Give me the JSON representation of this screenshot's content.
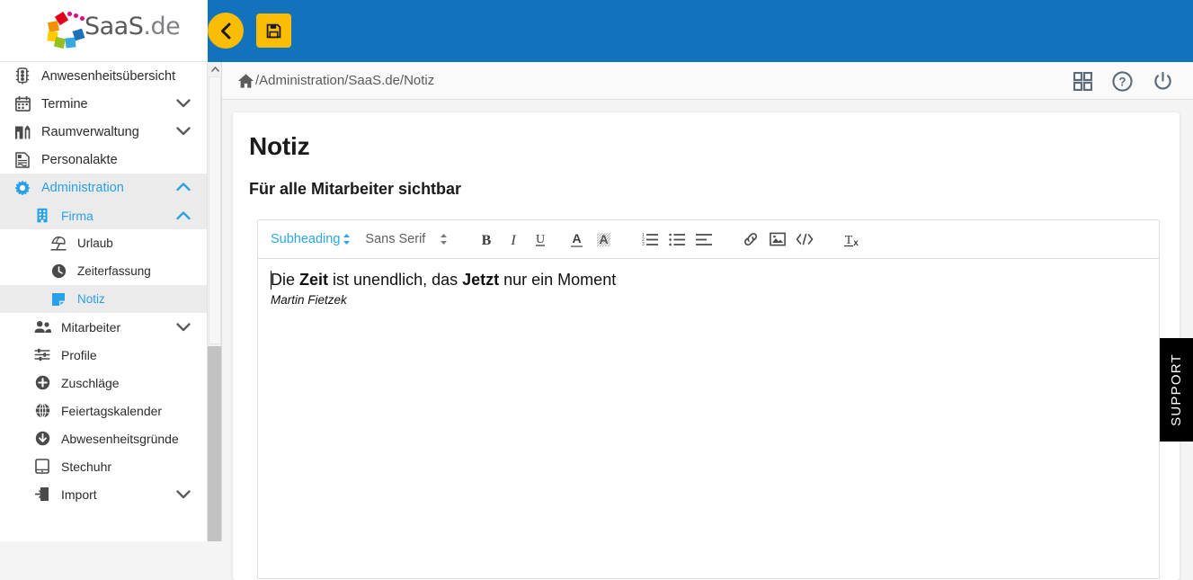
{
  "brand": {
    "name": "SaaS",
    "suffix": ".de",
    "logo_colors": [
      "#e2001a",
      "#f39200",
      "#ffcc00",
      "#95c11f",
      "#36a9e1",
      "#1d71b8",
      "#e6007e"
    ],
    "accent_yellow": "#fbbc04",
    "header_blue": "#1273bc",
    "link_blue": "#29a0e8"
  },
  "header": {
    "back_label": "Zurück",
    "back_icon": "chevron-left-icon",
    "save_label": "Speichern",
    "save_icon": "floppy-disk-icon"
  },
  "breadcrumb": {
    "home_icon": "home-icon",
    "path": "/Administration/SaaS.de/Notiz"
  },
  "header_icons": [
    {
      "name": "apps-grid-icon",
      "title": "Apps"
    },
    {
      "name": "help-circle-icon",
      "title": "Hilfe"
    },
    {
      "name": "power-icon",
      "title": "Abmelden"
    }
  ],
  "sidebar": {
    "scrollbar": {
      "up_arrow_icon": "chevron-up-icon"
    },
    "items": [
      {
        "label": "Anwesenheitsübersicht",
        "icon": "traffic-light-icon",
        "level": 1,
        "active": false,
        "chevron": ""
      },
      {
        "label": "Termine",
        "icon": "calendar-icon",
        "level": 1,
        "active": false,
        "chevron": "down"
      },
      {
        "label": "Raumverwaltung",
        "icon": "building-door-icon",
        "level": 1,
        "active": false,
        "chevron": "down"
      },
      {
        "label": "Personalakte",
        "icon": "document-person-icon",
        "level": 1,
        "active": false,
        "chevron": ""
      },
      {
        "label": "Administration",
        "icon": "gear-icon",
        "level": 1,
        "active": true,
        "chevron": "up"
      },
      {
        "label": "Firma",
        "icon": "office-building-icon",
        "level": 2,
        "active": true,
        "chevron": "up"
      },
      {
        "label": "Urlaub",
        "icon": "beach-umbrella-icon",
        "level": 3,
        "active": false,
        "chevron": ""
      },
      {
        "label": "Zeiterfassung",
        "icon": "clock-icon",
        "level": 3,
        "active": false,
        "chevron": ""
      },
      {
        "label": "Notiz",
        "icon": "note-icon",
        "level": 3,
        "active": true,
        "chevron": ""
      },
      {
        "label": "Mitarbeiter",
        "icon": "people-icon",
        "level": 2,
        "active": false,
        "chevron": "down"
      },
      {
        "label": "Profile",
        "icon": "sliders-icon",
        "level": 2,
        "active": false,
        "chevron": ""
      },
      {
        "label": "Zuschläge",
        "icon": "plus-circle-icon",
        "level": 2,
        "active": false,
        "chevron": ""
      },
      {
        "label": "Feiertagskalender",
        "icon": "globe-icon",
        "level": 2,
        "active": false,
        "chevron": ""
      },
      {
        "label": "Abwesenheitsgründe",
        "icon": "arrow-down-circle-icon",
        "level": 2,
        "active": false,
        "chevron": ""
      },
      {
        "label": "Stechuhr",
        "icon": "tablet-icon",
        "level": 2,
        "active": false,
        "chevron": ""
      },
      {
        "label": "Import",
        "icon": "import-icon",
        "level": 2,
        "active": false,
        "chevron": "down"
      }
    ]
  },
  "page": {
    "title": "Notiz",
    "subtitle": "Für alle Mitarbeiter sichtbar"
  },
  "editor": {
    "toolbar": {
      "heading_select": "Subheading",
      "font_select": "Sans Serif",
      "buttons": [
        {
          "name": "bold-button",
          "label": "B"
        },
        {
          "name": "italic-button",
          "label": "I"
        },
        {
          "name": "underline-button",
          "label": "U"
        },
        {
          "name": "text-color-button",
          "label": "A"
        },
        {
          "name": "background-color-button",
          "label": "A"
        },
        {
          "name": "ordered-list-button",
          "label": ""
        },
        {
          "name": "unordered-list-button",
          "label": ""
        },
        {
          "name": "align-button",
          "label": ""
        },
        {
          "name": "link-button",
          "label": ""
        },
        {
          "name": "image-button",
          "label": ""
        },
        {
          "name": "code-button",
          "label": "</>"
        },
        {
          "name": "clear-format-button",
          "label": "Tx"
        }
      ]
    },
    "content": {
      "line1_part1": "Die ",
      "line1_bold1": "Zeit",
      "line1_part2": " ist unendlich, das ",
      "line1_bold2": "Jetzt",
      "line1_part3": " nur ein Moment",
      "line2_author": "Martin Fietzek"
    }
  },
  "support": {
    "label": "SUPPORT"
  }
}
